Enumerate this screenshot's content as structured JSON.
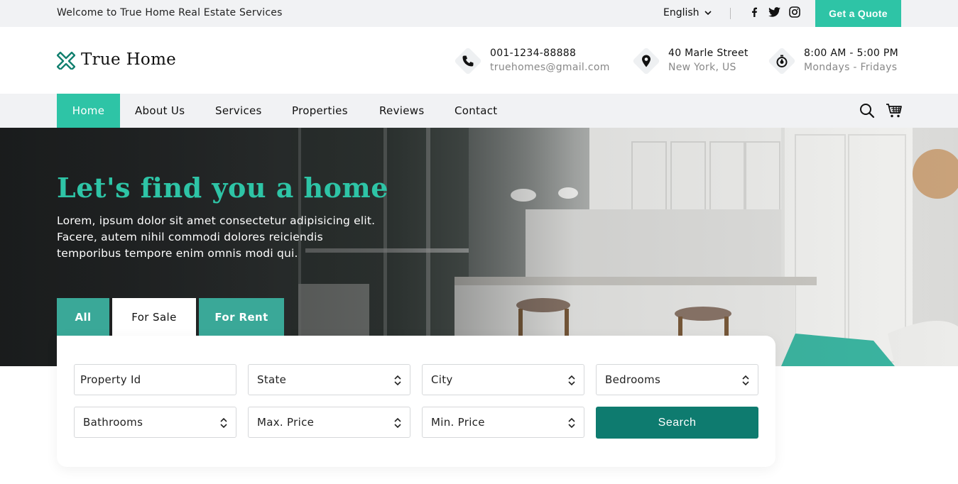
{
  "topbar": {
    "welcome": "Welcome to True Home Real Estate Services",
    "language": "English",
    "social": [
      "facebook-icon",
      "twitter-icon",
      "instagram-icon"
    ],
    "quote_label": "Get a Quote"
  },
  "header": {
    "logo_text": "True Home",
    "contact": {
      "phone": "001-1234-88888",
      "email": "truehomes@gmail.com",
      "street": "40 Marle Street",
      "city": "New York, US",
      "hours": "8:00 AM - 5:00 PM",
      "days": "Mondays - Fridays"
    }
  },
  "nav": {
    "items": [
      "Home",
      "About Us",
      "Services",
      "Properties",
      "Reviews",
      "Contact"
    ],
    "active": "Home"
  },
  "hero": {
    "title": "Let's find you a home",
    "description": "Lorem, ipsum dolor sit amet consectetur adipisicing elit. Facere, autem nihil commodi dolores reiciendis temporibus tempore enim omnis modi qui."
  },
  "tabs": [
    "All",
    "For Sale",
    "For Rent"
  ],
  "active_tab": "For Sale",
  "search": {
    "fields": {
      "property_id": "Property Id",
      "state": "State",
      "city": "City",
      "bedrooms": "Bedrooms",
      "bathrooms": "Bathrooms",
      "max_price": "Max. Price",
      "min_price": "Min. Price"
    },
    "button_label": "Search"
  },
  "colors": {
    "accent": "#2ec4a6",
    "tab": "#3aa898",
    "button": "#0e7b6f",
    "bar_bg": "#f1f2f4"
  }
}
